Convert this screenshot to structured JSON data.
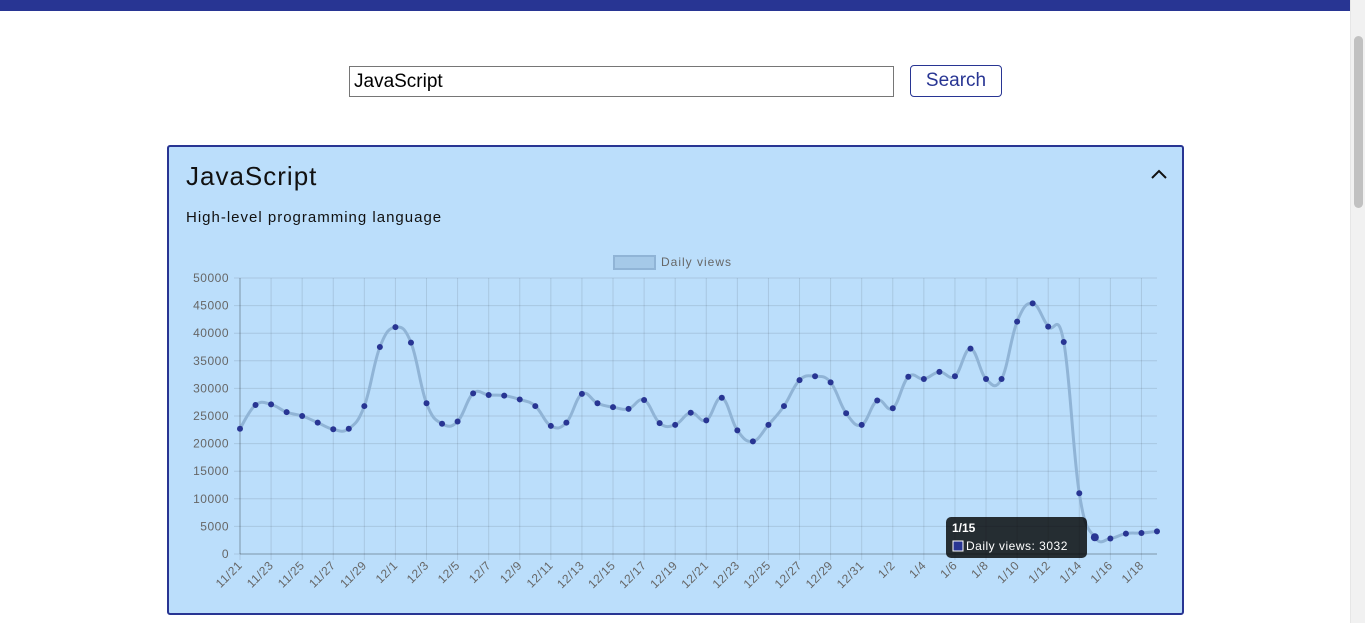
{
  "search": {
    "value": "JavaScript",
    "button_label": "Search"
  },
  "card": {
    "title": "JavaScript",
    "description": "High-level programming language"
  },
  "icons": {
    "collapse": "chevron-up-icon"
  },
  "colors": {
    "topbar": "#283593",
    "card_bg": "#bbdefb",
    "line": "#90b4d6",
    "point": "#283593"
  },
  "tooltip": {
    "title": "1/15",
    "text": "Daily views: 3032"
  },
  "chart_data": {
    "type": "line",
    "legend": "top",
    "series": [
      {
        "name": "Daily views"
      }
    ],
    "ylim": [
      0,
      50000
    ],
    "yticks": [
      0,
      5000,
      10000,
      15000,
      20000,
      25000,
      30000,
      35000,
      40000,
      45000,
      50000
    ],
    "grid": true,
    "x": [
      "11/21",
      "11/22",
      "11/23",
      "11/24",
      "11/25",
      "11/26",
      "11/27",
      "11/28",
      "11/29",
      "11/30",
      "12/1",
      "12/2",
      "12/3",
      "12/4",
      "12/5",
      "12/6",
      "12/7",
      "12/8",
      "12/9",
      "12/10",
      "12/11",
      "12/12",
      "12/13",
      "12/14",
      "12/15",
      "12/16",
      "12/17",
      "12/18",
      "12/19",
      "12/20",
      "12/21",
      "12/22",
      "12/23",
      "12/24",
      "12/25",
      "12/26",
      "12/27",
      "12/28",
      "12/29",
      "12/30",
      "12/31",
      "1/1",
      "1/2",
      "1/3",
      "1/4",
      "1/5",
      "1/6",
      "1/7",
      "1/8",
      "1/9",
      "1/10",
      "1/11",
      "1/12",
      "1/13",
      "1/14",
      "1/15",
      "1/16",
      "1/17",
      "1/18",
      "1/19"
    ],
    "values": [
      22700,
      27000,
      27100,
      25700,
      25000,
      23800,
      22600,
      22700,
      26800,
      37500,
      41100,
      38300,
      27300,
      23600,
      24000,
      29100,
      28800,
      28700,
      28000,
      26800,
      23200,
      23800,
      29000,
      27300,
      26600,
      26300,
      27900,
      23700,
      23400,
      25600,
      24200,
      28300,
      22400,
      20400,
      23400,
      26800,
      31500,
      32200,
      31100,
      25500,
      23400,
      27800,
      26400,
      32100,
      31700,
      33000,
      32200,
      37200,
      31700,
      31700,
      42100,
      45400,
      41200,
      38400,
      11000,
      3032,
      2800,
      3700,
      3800,
      4100
    ],
    "xtick_labels": [
      "11/21",
      "11/23",
      "11/25",
      "11/27",
      "11/29",
      "12/1",
      "12/3",
      "12/5",
      "12/7",
      "12/9",
      "12/11",
      "12/13",
      "12/15",
      "12/17",
      "12/19",
      "12/21",
      "12/23",
      "12/25",
      "12/27",
      "12/29",
      "12/31",
      "1/2",
      "1/4",
      "1/6",
      "1/8",
      "1/10",
      "1/12",
      "1/14",
      "1/16",
      "1/18"
    ]
  }
}
